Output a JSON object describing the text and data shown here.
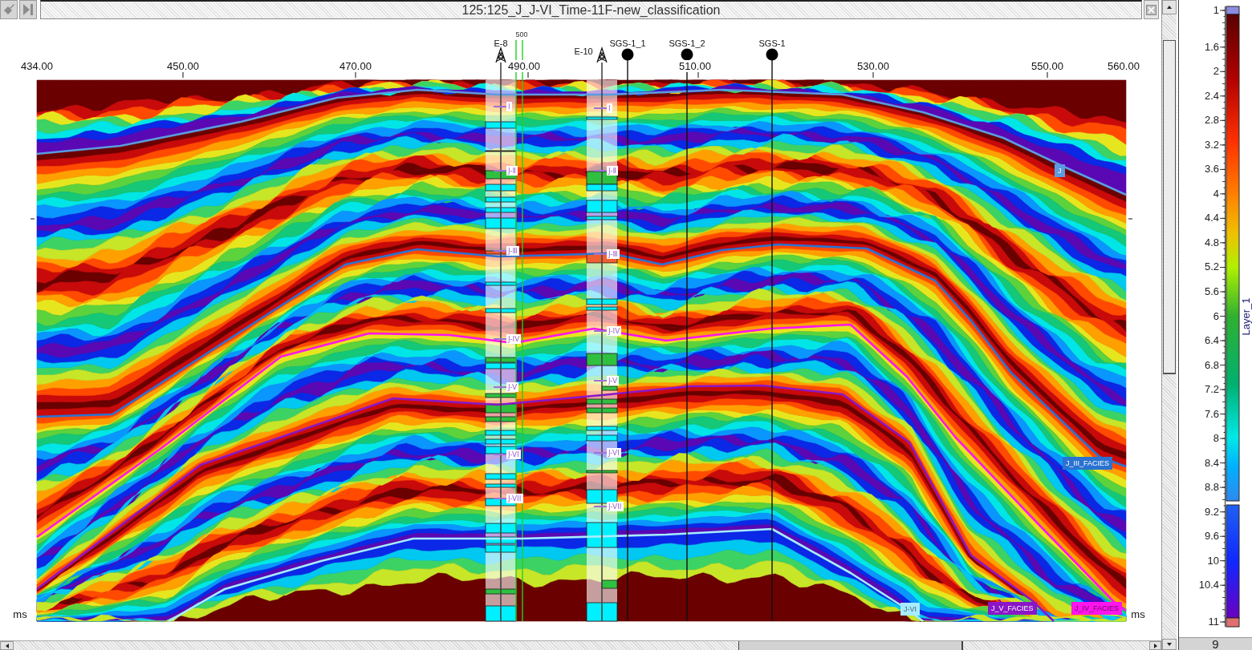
{
  "window": {
    "title": "125:125_J_J-VI_Time-11F-new_classification"
  },
  "x_axis": {
    "ticks": [
      "434.00",
      "450.00",
      "470.00",
      "490.00",
      "510.00",
      "530.00",
      "550.00",
      "560.00"
    ]
  },
  "unit_labels": [
    "ms",
    "ms"
  ],
  "trace_marker": {
    "label": "500"
  },
  "wells": [
    {
      "name": "E-8",
      "kind": "derrick",
      "markers": [
        "Ⅰ",
        "J-Ⅱ",
        "J-Ⅲ",
        "J-IV",
        "J-V",
        "J-VI",
        "J-VII"
      ]
    },
    {
      "name": "E-10",
      "kind": "derrick",
      "markers": [
        "Ⅰ",
        "J-Ⅱ",
        "J-Ⅲ",
        "J-IV",
        "J-V",
        "J-VI",
        "J-VII"
      ]
    },
    {
      "name": "SGS-1_1",
      "kind": "dot"
    },
    {
      "name": "SGS-1_2",
      "kind": "dot"
    },
    {
      "name": "SGS-1",
      "kind": "dot"
    }
  ],
  "horizons": [
    {
      "name": "J",
      "color": "#5b9be0"
    },
    {
      "name": "J_III_FACIES",
      "color": "#2a72d2"
    },
    {
      "name": "J-VI",
      "color": "#a6ecff"
    },
    {
      "name": "J_V_FACIES",
      "color": "#8a16c8"
    },
    {
      "name": "J_IV_FACIES",
      "color": "#ff14ee"
    }
  ],
  "color_scale": {
    "label": "Layer_1",
    "ticks": [
      "1",
      "1.6",
      "2",
      "2.4",
      "2.8",
      "3.2",
      "3.6",
      "4",
      "4.4",
      "4.8",
      "5.2",
      "5.6",
      "6",
      "6.4",
      "6.8",
      "7.2",
      "7.6",
      "8",
      "8.4",
      "8.8",
      "9.2",
      "9.6",
      "10",
      "10.4",
      "11"
    ]
  },
  "status": {
    "value": "9"
  }
}
